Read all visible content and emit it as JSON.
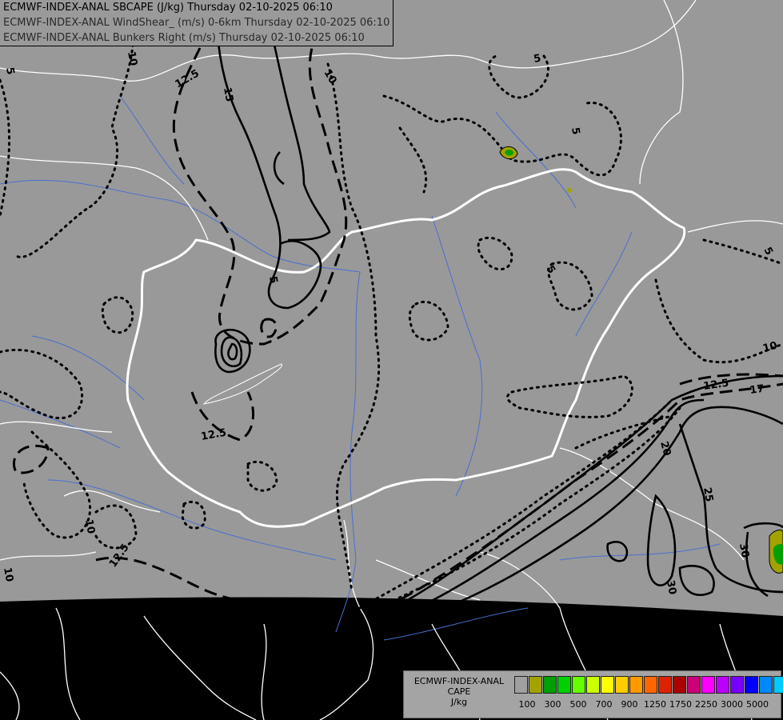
{
  "titles": [
    "ECMWF-INDEX-ANAL SBCAPE (J/kg) Thursday 02-10-2025 06:10",
    "ECMWF-INDEX-ANAL WindShear_ (m/s) 0-6km Thursday 02-10-2025 06:10",
    "ECMWF-INDEX-ANAL Bunkers Right (m/s) Thursday 02-10-2025 06:10"
  ],
  "legend": {
    "label_lines": [
      "ECMWF-INDEX-ANAL",
      "CAPE",
      "J/kg"
    ],
    "colors": [
      "#a0a0a0",
      "#a3a300",
      "#00a000",
      "#00d000",
      "#66ff00",
      "#ccff00",
      "#ffff00",
      "#ffcc00",
      "#ff9900",
      "#ff6600",
      "#dd2200",
      "#aa0000",
      "#cc0077",
      "#ff00ff",
      "#bb00ff",
      "#7700ff",
      "#0000ff",
      "#0088ff",
      "#00ccff",
      "#66ffff",
      "#ffffff"
    ],
    "ticks": [
      "100",
      "300",
      "500",
      "700",
      "900",
      "1250",
      "1750",
      "2250",
      "3000",
      "5000"
    ]
  },
  "contour_labels": [
    "12.5",
    "15",
    "10",
    "5",
    "5",
    "5",
    "5",
    "10",
    "12.5",
    "17",
    "20",
    "25",
    "30",
    "30",
    "12.5",
    "10",
    "10",
    "12.5",
    "10",
    "5",
    "5"
  ]
}
